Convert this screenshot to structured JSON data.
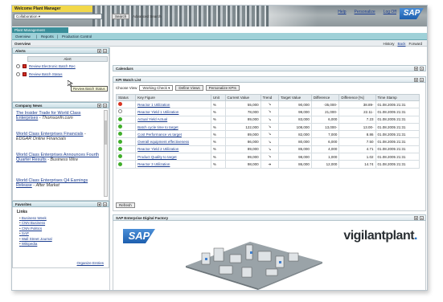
{
  "header": {
    "welcome": "Welcome Plant Manager",
    "links": [
      "Help",
      "Personalize",
      "Log Off"
    ],
    "collab": "Collaboration",
    "search_button": "Search",
    "search_scope": "Advanced Search",
    "sap": "SAP"
  },
  "nav": {
    "tab": "Plant Management",
    "items": [
      "Overview",
      "Reports",
      "Production Control"
    ]
  },
  "toolbar": {
    "title": "Overview",
    "history": "History",
    "back": "Back",
    "forward": "Forward"
  },
  "alerts": {
    "title": "Alerts",
    "column": "Alert",
    "rows": [
      "Review Electronic Batch Rec",
      "Review Batch Status"
    ],
    "tooltip": "Review Batch Status"
  },
  "news": {
    "title": "Company News",
    "items": [
      {
        "title": "The Insider Trade for World Class Enterprises",
        "source": "Thomsonfn.com"
      },
      {
        "title": "World Class Enterprises Financials",
        "source": "EDGAR Online Financials"
      },
      {
        "title": "World Class Enterprises Announces Fourth Quarter Results",
        "source": "Business Wire"
      },
      {
        "title": "World Class Enterprises Q4 Earnings Release",
        "source": "After Market"
      }
    ]
  },
  "favorites": {
    "title": "Favorites",
    "links_title": "Links",
    "links": [
      "Business Week",
      "CNN Business",
      "CNN Politics",
      "SAP",
      "Wall Street Journal",
      "Wikipedia"
    ],
    "organize": "Organize Entries"
  },
  "main": {
    "calendar": "Calendars",
    "kpi_title": "KPI Watch List",
    "choose_view": "Choose View",
    "view_value": "Working Check",
    "btn1": "Define Views",
    "btn2": "Personalize KPIs",
    "refresh": "Refresh",
    "factory_title": "SAP Enterprise Digital Factory",
    "vigilant": "vigilantplant"
  },
  "kpi_table": {
    "headers": [
      "Status",
      "Key Figure",
      "Unit",
      "Current Value",
      "Trend",
      "Target Value",
      "Difference",
      "Difference [%]",
      "Time Stamp"
    ],
    "rows": [
      {
        "status": "red",
        "name": "Reactor 1 Utilization",
        "unit": "%",
        "cur": "55,000",
        "trend": "down",
        "tgt": "90,000",
        "diff": "-35,000-",
        "pct": "38.89-",
        "ts": "01.08.2005 21:31"
      },
      {
        "status": "warn",
        "name": "Reactor Yield 1 Utilization",
        "unit": "%",
        "cur": "78,000",
        "trend": "down",
        "tgt": "99,000",
        "diff": "21,000-",
        "pct": "22.11-",
        "ts": "01.08.2005 21:31"
      },
      {
        "status": "green",
        "name": "Actual Yield Actual",
        "unit": "%",
        "cur": "89,000",
        "trend": "down",
        "tgt": "83,000",
        "diff": "6,000",
        "pct": "7.23",
        "ts": "01.08.2005 21:31"
      },
      {
        "status": "green",
        "name": "Batch cycle time to target",
        "unit": "%",
        "cur": "122,000",
        "trend": "down",
        "tgt": "108,000",
        "diff": "13,000-",
        "pct": "13.00-",
        "ts": "01.08.2005 21:31"
      },
      {
        "status": "green",
        "name": "Cost Performance vs target",
        "unit": "%",
        "cur": "89,000",
        "trend": "down",
        "tgt": "82,000",
        "diff": "7,000",
        "pct": "8.86",
        "ts": "01.08.2005 21:31"
      },
      {
        "status": "green",
        "name": "Overall equipment effectiveness",
        "unit": "%",
        "cur": "86,000",
        "trend": "down",
        "tgt": "80,000",
        "diff": "6,000",
        "pct": "7.50",
        "ts": "01.08.2005 21:31"
      },
      {
        "status": "green",
        "name": "Reactor Yield 2 Utilization",
        "unit": "%",
        "cur": "89,000",
        "trend": "down",
        "tgt": "85,000",
        "diff": "4,000",
        "pct": "4.71",
        "ts": "01.08.2005 21:31"
      },
      {
        "status": "green",
        "name": "Product Quality to target",
        "unit": "%",
        "cur": "99,000",
        "trend": "down",
        "tgt": "98,000",
        "diff": "1,000",
        "pct": "1.02",
        "ts": "01.08.2005 21:31"
      },
      {
        "status": "green",
        "name": "Reactor 3 Utilization",
        "unit": "%",
        "cur": "98,000",
        "trend": "right",
        "tgt": "86,000",
        "diff": "12,000",
        "pct": "14.74",
        "ts": "01.08.2005 21:31"
      }
    ]
  },
  "colors": {
    "red": "#d9331f",
    "green": "#3fae2a",
    "warn": "#888888",
    "accent": "#1e6fc9"
  }
}
